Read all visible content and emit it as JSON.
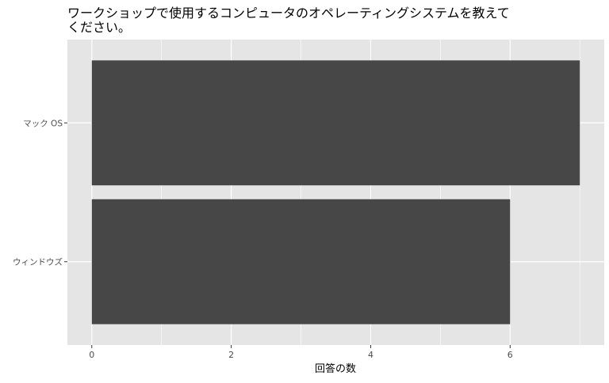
{
  "chart_data": {
    "type": "bar",
    "orientation": "horizontal",
    "title_lines": [
      "ワークショップで使用するコンピュータのオペレーティングシステムを教えて",
      "ください。"
    ],
    "categories": [
      "マック OS",
      "ウィンドウズ"
    ],
    "values": [
      7,
      6
    ],
    "xlabel": "回答の数",
    "ylabel": "",
    "xlim": [
      -0.35,
      7.35
    ],
    "xticks": [
      "0",
      "2",
      "4",
      "6"
    ],
    "grid": true,
    "colors": {
      "bar": "#474747",
      "panel": "#e5e5e5",
      "grid": "#ffffff",
      "text": "#4d4d4d"
    }
  }
}
